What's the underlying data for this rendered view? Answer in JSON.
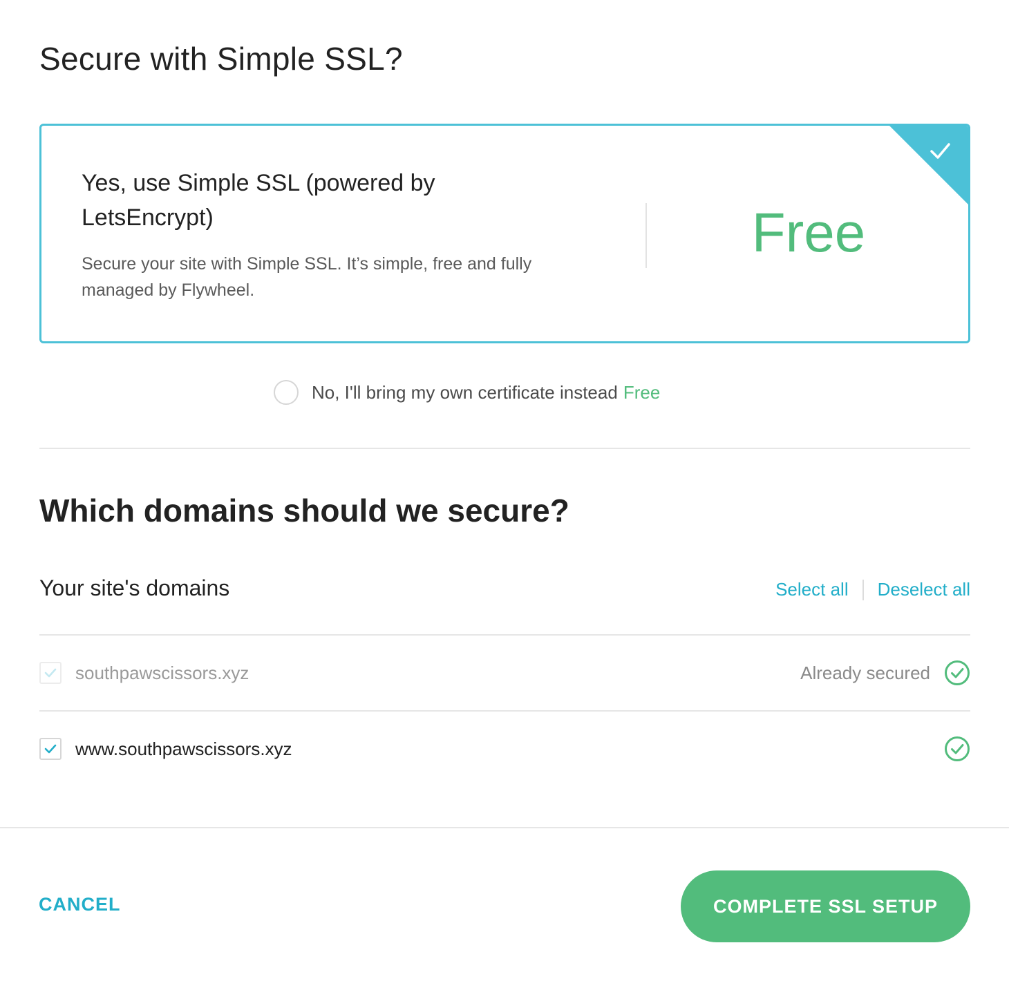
{
  "title": "Secure with Simple SSL?",
  "ssl_option": {
    "heading": "Yes, use Simple SSL (powered by LetsEncrypt)",
    "description": "Secure your site with Simple SSL. It’s simple, free and fully managed by Flywheel.",
    "price": "Free",
    "selected": true
  },
  "alt_option": {
    "label": "No, I'll bring my own certificate instead",
    "price": "Free",
    "selected": false
  },
  "domains": {
    "title": "Which domains should we secure?",
    "subtitle": "Your site's domains",
    "select_all": "Select all",
    "deselect_all": "Deselect all",
    "rows": [
      {
        "name": "southpawscissors.xyz",
        "checked": true,
        "disabled": true,
        "status": "Already secured",
        "status_icon": "check-circle-icon"
      },
      {
        "name": "www.southpawscissors.xyz",
        "checked": true,
        "disabled": false,
        "status": "",
        "status_icon": "check-circle-icon"
      }
    ]
  },
  "footer": {
    "cancel_label": "CANCEL",
    "complete_label": "COMPLETE SSL SETUP"
  },
  "colors": {
    "accent_blue": "#4cc1d7",
    "link_blue": "#22aec9",
    "green": "#52bc7c"
  }
}
